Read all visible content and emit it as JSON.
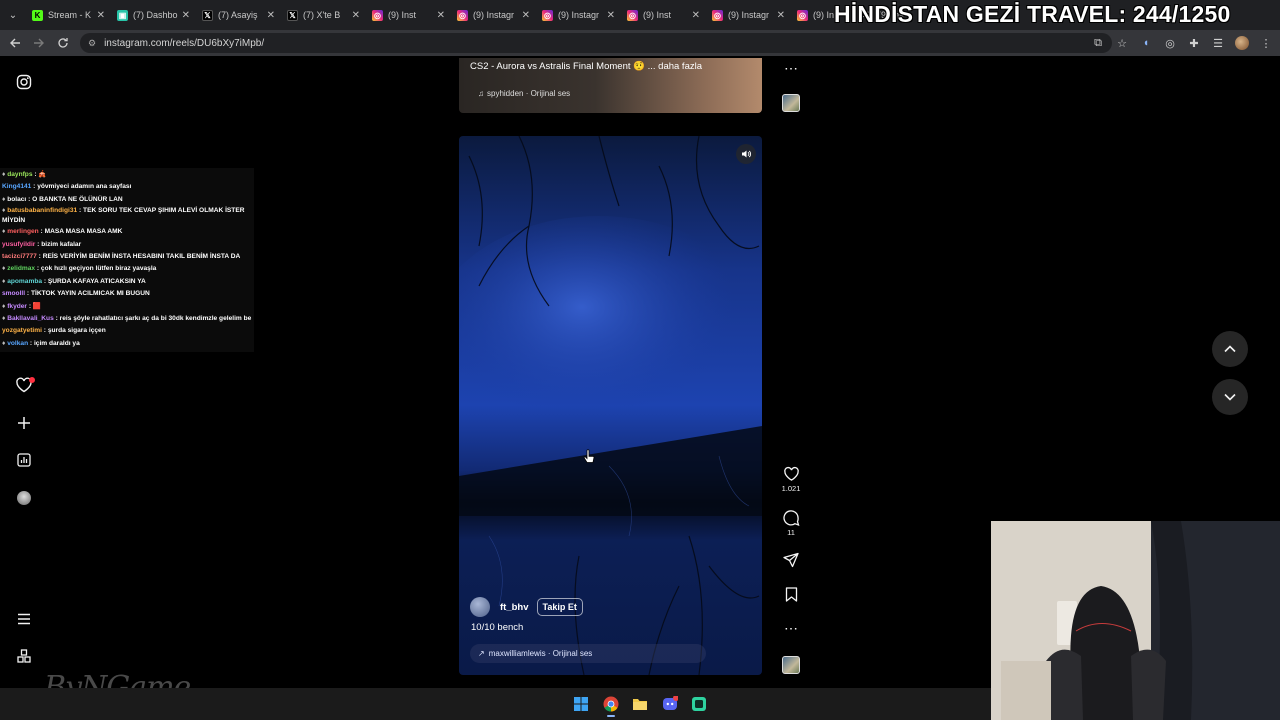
{
  "browser": {
    "tabs": [
      {
        "label": "Stream - K",
        "icon": "kick-icon"
      },
      {
        "label": "(7) Dashbo",
        "icon": "dashboard-icon"
      },
      {
        "label": "(7) Asayiş",
        "icon": "x-logo-icon"
      },
      {
        "label": "(7) X'te B",
        "icon": "x-logo-icon"
      },
      {
        "label": "(9) Inst",
        "icon": "instagram-icon"
      },
      {
        "label": "(9) Instagr",
        "icon": "instagram-icon"
      },
      {
        "label": "(9) Instagr",
        "icon": "instagram-icon"
      },
      {
        "label": "(9) Inst",
        "icon": "instagram-icon"
      },
      {
        "label": "(9) Instagr",
        "icon": "instagram-icon"
      },
      {
        "label": "(9) In",
        "icon": "instagram-icon"
      }
    ],
    "tail_tab_label": "(9) Ins",
    "url": "instagram.com/reels/DU6bXy7iMpb/"
  },
  "overlay": {
    "title": "HİNDİSTAN GEZİ TRAVEL: 244/1250"
  },
  "previous_reel": {
    "caption": "CS2 - Aurora vs Astralis Final Moment 🤨 ... daha fazla",
    "audio": "spyhidden · Orijinal ses"
  },
  "reel": {
    "author": "ft_bhv",
    "follow_label": "Takip Et",
    "caption": "10/10 bench",
    "audio": "maxwilliamlewis · Orijinal ses",
    "likes": "1.021",
    "comments": "11"
  },
  "chat": [
    {
      "user": "daynfps",
      "user_color": "#9ae65a",
      "text": " : 🎪",
      "badge": true
    },
    {
      "user": "King4141",
      "user_color": "#58a6ff",
      "text": " : yövmiyeci adamın ana sayfası",
      "badge": false
    },
    {
      "user": "bolacı",
      "user_color": "#ffffff",
      "text": " : O BANKTA NE ÖLÜNÜR LAN",
      "badge": true
    },
    {
      "user": "batusbabaninfindigi31",
      "user_color": "#ffb347",
      "text": " : TEK SORU TEK CEVAP ŞIHIM ALEVİ OLMAK İSTER MİYDİN",
      "badge": true,
      "wrap": true
    },
    {
      "user": "merlingen",
      "user_color": "#ff5f5f",
      "text": " : MASA MASA MASA AMK",
      "badge": true
    },
    {
      "user": "yusufyildir",
      "user_color": "#ff5fa2",
      "text": " : bizim kafalar",
      "badge": false
    },
    {
      "user": "tacizci7777",
      "user_color": "#ff7b7b",
      "text": " : REİS VERİYİM BENİM İNSTA HESABINI TAKIL BENİM İNSTA DA",
      "badge": false
    },
    {
      "user": "zelidmax",
      "user_color": "#5fd45f",
      "text": " : çok hızlı geçiyon lütfen biraz yavaşla",
      "badge": true
    },
    {
      "user": "apomamba",
      "user_color": "#5fd4d4",
      "text": " : ŞURDA KAFAYA ATICAKSIN YA",
      "badge": true
    },
    {
      "user": "smoolll",
      "user_color": "#c58aff",
      "text": " : TİKTOK YAYIN ACILMICAK MI BUGUN",
      "badge": false
    },
    {
      "user": "fkyder",
      "user_color": "#c58aff",
      "text": " : 🟥",
      "badge": true
    },
    {
      "user": "Bakllavali_Kus",
      "user_color": "#c58aff",
      "text": " : reis şöyle rahatlatıcı şarkı aç da bi 30dk kendimzle gelelim be",
      "badge": true
    },
    {
      "user": "yozgatyetimi",
      "user_color": "#ffb347",
      "text": " : şurda sigara iççen",
      "badge": false
    },
    {
      "user": "volkan",
      "user_color": "#58a6ff",
      "text": " : içim daraldı ya",
      "badge": true
    }
  ],
  "watermark": "ByNGame"
}
